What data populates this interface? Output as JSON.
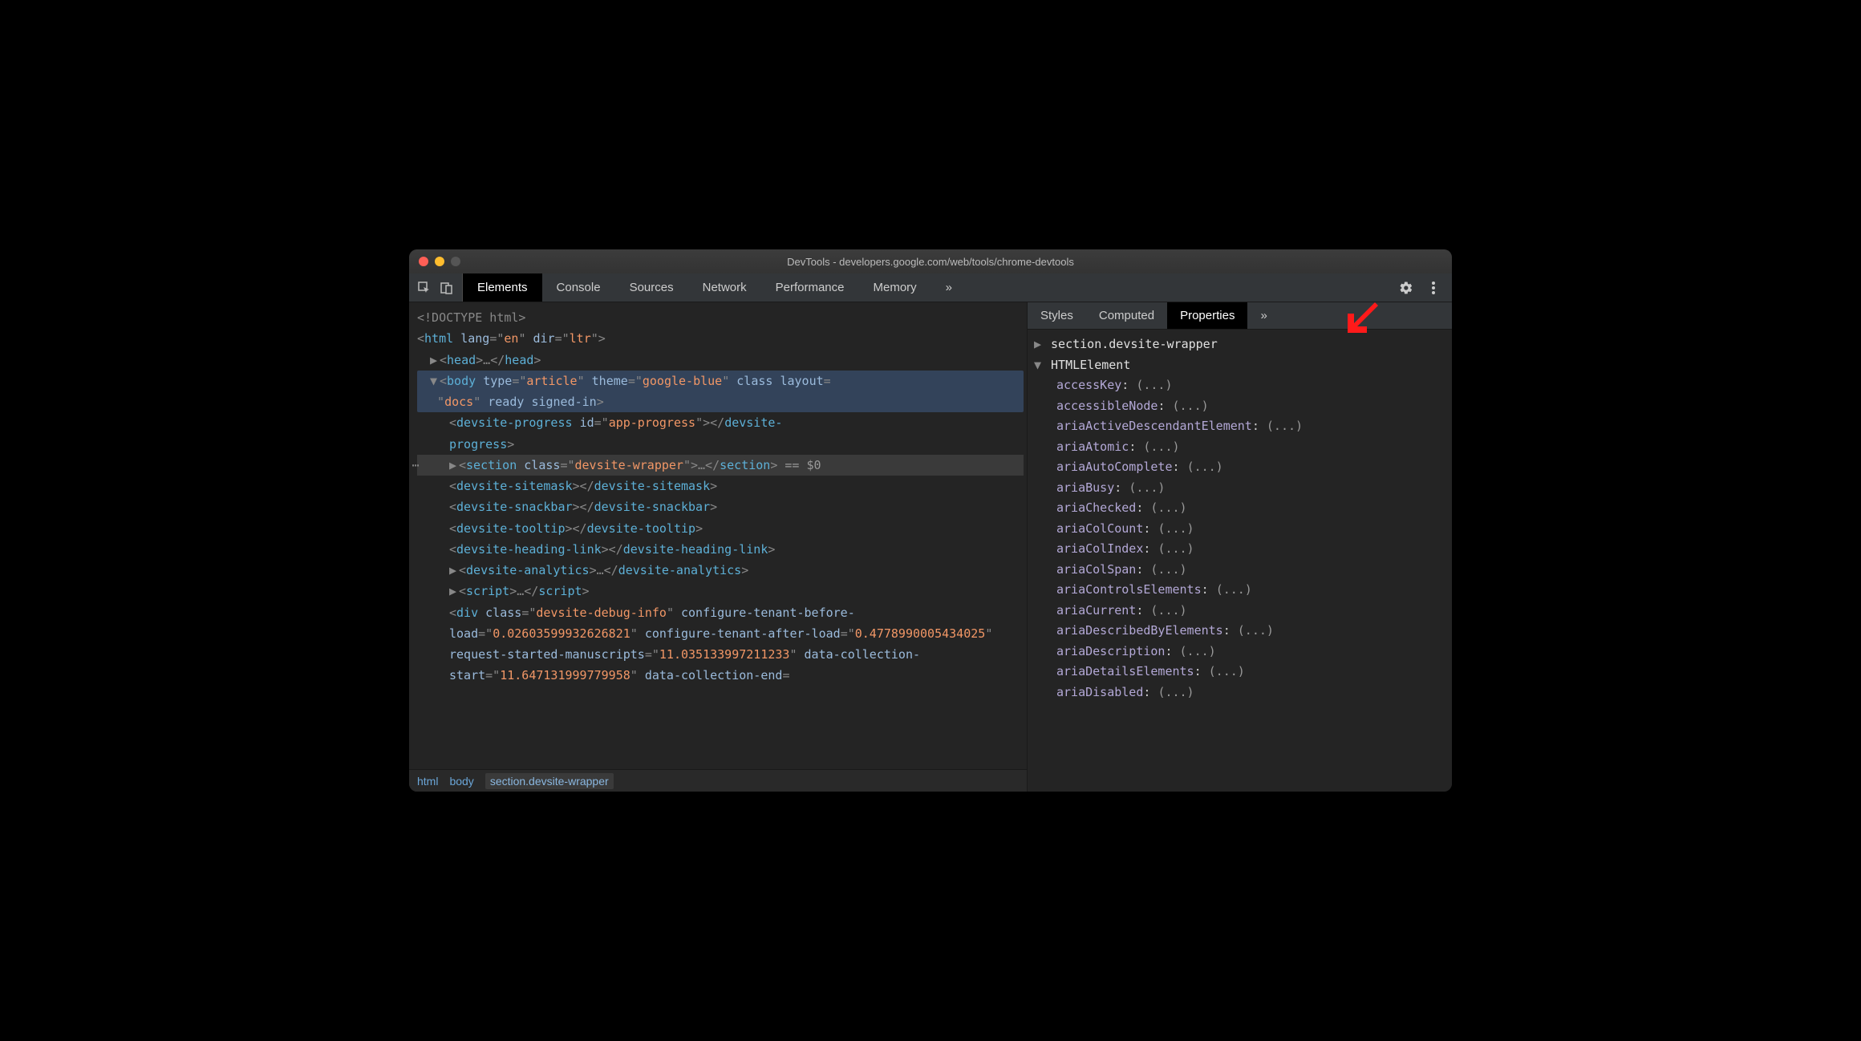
{
  "window": {
    "title": "DevTools - developers.google.com/web/tools/chrome-devtools"
  },
  "mainTabs": [
    "Elements",
    "Console",
    "Sources",
    "Network",
    "Performance",
    "Memory"
  ],
  "activeMainTab": 0,
  "sideTabs": [
    "Styles",
    "Computed",
    "Properties"
  ],
  "activeSideTab": 2,
  "breadcrumb": [
    "html",
    "body",
    "section.devsite-wrapper"
  ],
  "activeBreadcrumb": 2,
  "domLines": {
    "doctype": "<!DOCTYPE html>",
    "htmlOpen": {
      "tag": "html",
      "attrs": [
        [
          "lang",
          "en"
        ],
        [
          "dir",
          "ltr"
        ]
      ]
    },
    "head": {
      "tag": "head"
    },
    "body": {
      "tag": "body",
      "attrPairs": [
        [
          "type",
          "article"
        ],
        [
          "theme",
          "google-blue"
        ]
      ],
      "bareAttrs": [
        "class"
      ],
      "layoutVal": "docs",
      "trailingBare": [
        "ready",
        "signed-in"
      ]
    },
    "progress": {
      "tag": "devsite-progress",
      "attrs": [
        [
          "id",
          "app-progress"
        ]
      ]
    },
    "section": {
      "tag": "section",
      "attrs": [
        [
          "class",
          "devsite-wrapper"
        ]
      ]
    },
    "sitemask": "devsite-sitemask",
    "snackbar": "devsite-snackbar",
    "tooltip": "devsite-tooltip",
    "headinglink": "devsite-heading-link",
    "analytics": "devsite-analytics",
    "script": "script",
    "div": {
      "tag": "div",
      "classVal": "devsite-debug-info",
      "pairs": [
        [
          "configure-tenant-before-load",
          "0.02603599932626821"
        ],
        [
          "configure-tenant-after-load",
          "0.4778990005434025"
        ],
        [
          "request-started-manuscripts",
          "11.035133997211233"
        ],
        [
          "data-collection-start",
          "11.647131999779958"
        ]
      ],
      "trailingAttr": "data-collection-end"
    },
    "eqDollar": " == $0"
  },
  "properties": {
    "header1": "section.devsite-wrapper",
    "header2": "HTMLElement",
    "rows": [
      "accessKey",
      "accessibleNode",
      "ariaActiveDescendantElement",
      "ariaAtomic",
      "ariaAutoComplete",
      "ariaBusy",
      "ariaChecked",
      "ariaColCount",
      "ariaColIndex",
      "ariaColSpan",
      "ariaControlsElements",
      "ariaCurrent",
      "ariaDescribedByElements",
      "ariaDescription",
      "ariaDetailsElements",
      "ariaDisabled"
    ],
    "valuePlaceholder": "(...)"
  }
}
